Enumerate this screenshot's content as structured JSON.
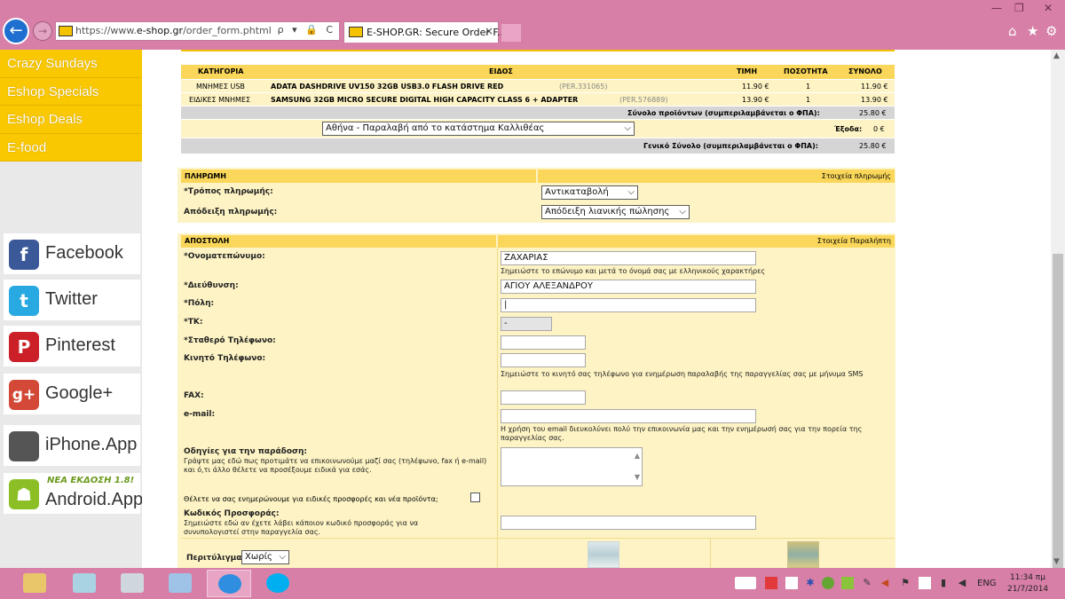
{
  "browser": {
    "url_prefix": "https://www.",
    "url_domain": "e-shop.gr",
    "url_path": "/order_form.phtml",
    "url_controls": "ρ ▾ 🔒 C",
    "tab_title": "E-SHOP.GR: Secure Order F...",
    "tab_close": "×",
    "min": "—",
    "max": "❐",
    "close": "✕",
    "home": "⌂",
    "fav": "★",
    "settings": "⚙",
    "back": "←",
    "fwd": "→"
  },
  "sidebar": {
    "menu": [
      "Crazy Sundays",
      "Eshop Specials",
      "Eshop Deals",
      "E-food"
    ],
    "social": [
      {
        "label": "Facebook",
        "icon": "f",
        "color": "#3b5998"
      },
      {
        "label": "Twitter",
        "icon": "t",
        "color": "#29a9e1"
      },
      {
        "label": "Pinterest",
        "icon": "P",
        "color": "#cb2027"
      },
      {
        "label": "Google+",
        "icon": "g+",
        "color": "#d34836"
      },
      {
        "label": "iPhone.App",
        "icon": "",
        "color": "#555555"
      },
      {
        "label": "Android.App",
        "icon": "☗",
        "color": "#8cbf26",
        "note": "ΝΕΑ ΕΚΔΟΣΗ 1.8!"
      }
    ]
  },
  "cart": {
    "headers": [
      "ΚΑΤΗΓΟΡΙΑ",
      "ΕΙΔΟΣ",
      "ΤΙΜΗ",
      "ΠΟΣΟΤΗΤΑ",
      "ΣΥΝΟΛΟ"
    ],
    "rows": [
      {
        "cat": "ΜΝΗΜΕΣ USB",
        "name": "ADATA DASHDRIVE UV150 32GB USB3.0 FLASH DRIVE RED",
        "code": "(PER.331065)",
        "price": "11.90 €",
        "qty": "1",
        "total": "11.90 €"
      },
      {
        "cat": "ΕΙΔΙΚΕΣ ΜΝΗΜΕΣ",
        "name": "SAMSUNG 32GB MICRO SECURE DIGITAL HIGH CAPACITY CLASS 6 + ADAPTER",
        "code": "(PER.576889)",
        "price": "13.90 €",
        "qty": "1",
        "total": "13.90 €"
      }
    ],
    "subtotal_label": "Σύνολο προϊόντων (συμπεριλαμβάνεται ο ΦΠΑ):",
    "subtotal": "25.80 €",
    "shipping_option": "Αθήνα - Παραλαβή από το κατάστημα Καλλιθέας",
    "expenses_label": "Έξοδα:",
    "expenses": "0 €",
    "grand_label": "Γενικό Σύνολο (συμπεριλαμβάνεται ο ΦΠΑ):",
    "grand": "25.80 €"
  },
  "payment": {
    "header": "ΠΛΗΡΩΜΗ",
    "header_right": "Στοιχεία πληρωμής",
    "method_label": "*Τρόπος πληρωμής:",
    "method": "Αντικαταβολή",
    "receipt_label": "Απόδειξη πληρωμής:",
    "receipt": "Απόδειξη λιανικής πώλησης"
  },
  "shipping": {
    "header": "ΑΠΟΣΤΟΛΗ",
    "header_right": "Στοιχεία Παραλήπτη",
    "name_label": "*Ονοματεπώνυμο:",
    "name_value": "ΖΑΧΑΡΙΑΣ",
    "name_hint": "Σημειώστε το επώνυμο και μετά το όνομά σας με ελληνικούς χαρακτήρες",
    "address_label": "*Διεύθυνση:",
    "address_value": "ΑΓΙΟΥ ΑΛΕΞΑΝΔΡΟΥ",
    "city_label": "*Πόλη:",
    "city_value": "|",
    "zip_label": "*ΤΚ:",
    "zip_value": "-",
    "phone_label": "*Σταθερό Τηλέφωνο:",
    "mobile_label": "Κινητό Τηλέφωνο:",
    "mobile_hint": "Σημειώστε το κινητό σας τηλέφωνο για ενημέρωση παραλαβής της παραγγελίας σας με μήνυμα SMS",
    "fax_label": "FAX:",
    "email_label": "e-mail:",
    "email_hint": "Η χρήση του email διευκολύνει πολύ την επικοινωνία μας και την ενημέρωσή σας για την πορεία της παραγγελίας σας.",
    "delivery_label": "Οδηγίες για την παράδοση:",
    "delivery_hint": "Γράψτε μας εδώ πως προτιμάτε να επικοινωνούμε μαζί σας (τηλέφωνο, fax ή e-mail) και ό,τι άλλο θέλετε να προσέξουμε ειδικά για εσάς.",
    "newsletter_label": "Θέλετε να σας ενημερώνουμε για ειδικές προσφορές και νέα προϊόντα;",
    "promo_label": "Κωδικός Προσφοράς:",
    "promo_hint": "Σημειώστε εδώ αν έχετε λάβει κάποιον κωδικό προσφοράς για να συνυπολογιστεί στην παραγγελία σας.",
    "wrap_label": "Περιτύλιγμα:",
    "wrap_value": "Χωρίς"
  },
  "taskbar": {
    "lang": "ENG",
    "time": "11:34 πμ",
    "date": "21/7/2014"
  }
}
